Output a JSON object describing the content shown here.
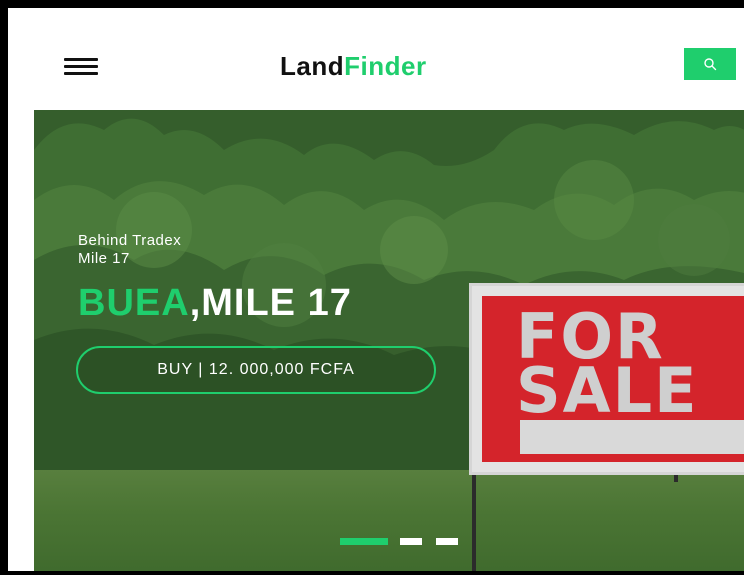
{
  "header": {
    "menu_icon": "hamburger-menu-icon",
    "brand_part1": "Land",
    "brand_part2": "Finder",
    "search_icon": "search-icon"
  },
  "hero": {
    "subtitle_line1": "Behind Tradex",
    "subtitle_line2": "Mile 17",
    "title_city": "BUEA",
    "title_rest": ",MILE 17",
    "buy_label": "BUY | 12. 000,000 FCFA",
    "sign_word_1": "FOR",
    "sign_word_2": "SALE"
  },
  "carousel": {
    "slide_count": 3,
    "active_index": 0
  },
  "colors": {
    "accent": "#1fce6d",
    "sign_red": "#d4242b",
    "dark": "#111111"
  }
}
